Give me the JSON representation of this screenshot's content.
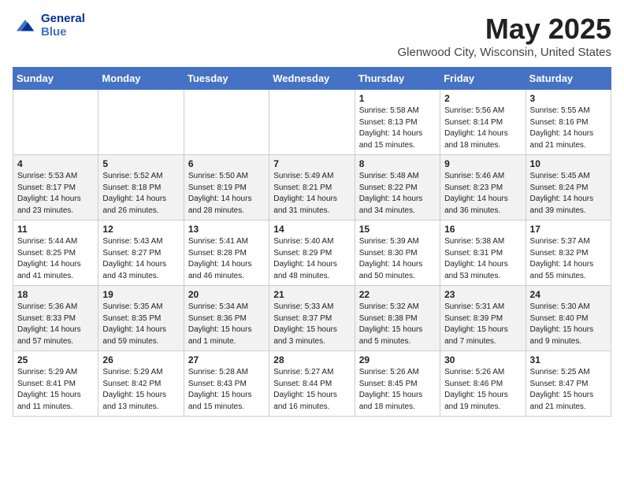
{
  "header": {
    "logo_line1": "General",
    "logo_line2": "Blue",
    "month": "May 2025",
    "location": "Glenwood City, Wisconsin, United States"
  },
  "days_of_week": [
    "Sunday",
    "Monday",
    "Tuesday",
    "Wednesday",
    "Thursday",
    "Friday",
    "Saturday"
  ],
  "weeks": [
    [
      {
        "day": "",
        "info": ""
      },
      {
        "day": "",
        "info": ""
      },
      {
        "day": "",
        "info": ""
      },
      {
        "day": "",
        "info": ""
      },
      {
        "day": "1",
        "info": "Sunrise: 5:58 AM\nSunset: 8:13 PM\nDaylight: 14 hours\nand 15 minutes."
      },
      {
        "day": "2",
        "info": "Sunrise: 5:56 AM\nSunset: 8:14 PM\nDaylight: 14 hours\nand 18 minutes."
      },
      {
        "day": "3",
        "info": "Sunrise: 5:55 AM\nSunset: 8:16 PM\nDaylight: 14 hours\nand 21 minutes."
      }
    ],
    [
      {
        "day": "4",
        "info": "Sunrise: 5:53 AM\nSunset: 8:17 PM\nDaylight: 14 hours\nand 23 minutes."
      },
      {
        "day": "5",
        "info": "Sunrise: 5:52 AM\nSunset: 8:18 PM\nDaylight: 14 hours\nand 26 minutes."
      },
      {
        "day": "6",
        "info": "Sunrise: 5:50 AM\nSunset: 8:19 PM\nDaylight: 14 hours\nand 28 minutes."
      },
      {
        "day": "7",
        "info": "Sunrise: 5:49 AM\nSunset: 8:21 PM\nDaylight: 14 hours\nand 31 minutes."
      },
      {
        "day": "8",
        "info": "Sunrise: 5:48 AM\nSunset: 8:22 PM\nDaylight: 14 hours\nand 34 minutes."
      },
      {
        "day": "9",
        "info": "Sunrise: 5:46 AM\nSunset: 8:23 PM\nDaylight: 14 hours\nand 36 minutes."
      },
      {
        "day": "10",
        "info": "Sunrise: 5:45 AM\nSunset: 8:24 PM\nDaylight: 14 hours\nand 39 minutes."
      }
    ],
    [
      {
        "day": "11",
        "info": "Sunrise: 5:44 AM\nSunset: 8:25 PM\nDaylight: 14 hours\nand 41 minutes."
      },
      {
        "day": "12",
        "info": "Sunrise: 5:43 AM\nSunset: 8:27 PM\nDaylight: 14 hours\nand 43 minutes."
      },
      {
        "day": "13",
        "info": "Sunrise: 5:41 AM\nSunset: 8:28 PM\nDaylight: 14 hours\nand 46 minutes."
      },
      {
        "day": "14",
        "info": "Sunrise: 5:40 AM\nSunset: 8:29 PM\nDaylight: 14 hours\nand 48 minutes."
      },
      {
        "day": "15",
        "info": "Sunrise: 5:39 AM\nSunset: 8:30 PM\nDaylight: 14 hours\nand 50 minutes."
      },
      {
        "day": "16",
        "info": "Sunrise: 5:38 AM\nSunset: 8:31 PM\nDaylight: 14 hours\nand 53 minutes."
      },
      {
        "day": "17",
        "info": "Sunrise: 5:37 AM\nSunset: 8:32 PM\nDaylight: 14 hours\nand 55 minutes."
      }
    ],
    [
      {
        "day": "18",
        "info": "Sunrise: 5:36 AM\nSunset: 8:33 PM\nDaylight: 14 hours\nand 57 minutes."
      },
      {
        "day": "19",
        "info": "Sunrise: 5:35 AM\nSunset: 8:35 PM\nDaylight: 14 hours\nand 59 minutes."
      },
      {
        "day": "20",
        "info": "Sunrise: 5:34 AM\nSunset: 8:36 PM\nDaylight: 15 hours\nand 1 minute."
      },
      {
        "day": "21",
        "info": "Sunrise: 5:33 AM\nSunset: 8:37 PM\nDaylight: 15 hours\nand 3 minutes."
      },
      {
        "day": "22",
        "info": "Sunrise: 5:32 AM\nSunset: 8:38 PM\nDaylight: 15 hours\nand 5 minutes."
      },
      {
        "day": "23",
        "info": "Sunrise: 5:31 AM\nSunset: 8:39 PM\nDaylight: 15 hours\nand 7 minutes."
      },
      {
        "day": "24",
        "info": "Sunrise: 5:30 AM\nSunset: 8:40 PM\nDaylight: 15 hours\nand 9 minutes."
      }
    ],
    [
      {
        "day": "25",
        "info": "Sunrise: 5:29 AM\nSunset: 8:41 PM\nDaylight: 15 hours\nand 11 minutes."
      },
      {
        "day": "26",
        "info": "Sunrise: 5:29 AM\nSunset: 8:42 PM\nDaylight: 15 hours\nand 13 minutes."
      },
      {
        "day": "27",
        "info": "Sunrise: 5:28 AM\nSunset: 8:43 PM\nDaylight: 15 hours\nand 15 minutes."
      },
      {
        "day": "28",
        "info": "Sunrise: 5:27 AM\nSunset: 8:44 PM\nDaylight: 15 hours\nand 16 minutes."
      },
      {
        "day": "29",
        "info": "Sunrise: 5:26 AM\nSunset: 8:45 PM\nDaylight: 15 hours\nand 18 minutes."
      },
      {
        "day": "30",
        "info": "Sunrise: 5:26 AM\nSunset: 8:46 PM\nDaylight: 15 hours\nand 19 minutes."
      },
      {
        "day": "31",
        "info": "Sunrise: 5:25 AM\nSunset: 8:47 PM\nDaylight: 15 hours\nand 21 minutes."
      }
    ]
  ]
}
